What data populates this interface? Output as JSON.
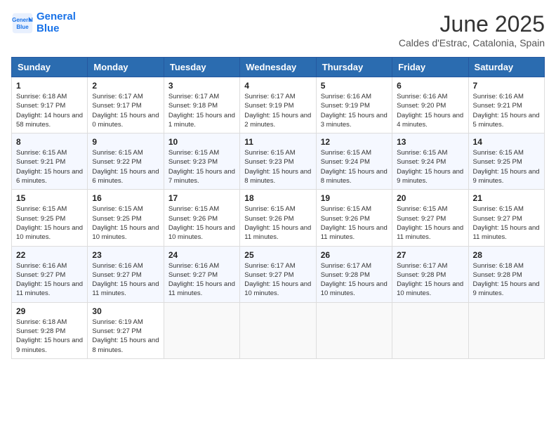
{
  "header": {
    "logo_line1": "General",
    "logo_line2": "Blue",
    "month_year": "June 2025",
    "location": "Caldes d'Estrac, Catalonia, Spain"
  },
  "days_of_week": [
    "Sunday",
    "Monday",
    "Tuesday",
    "Wednesday",
    "Thursday",
    "Friday",
    "Saturday"
  ],
  "weeks": [
    [
      {
        "day": "1",
        "sunrise": "6:18 AM",
        "sunset": "9:17 PM",
        "daylight": "14 hours and 58 minutes."
      },
      {
        "day": "2",
        "sunrise": "6:17 AM",
        "sunset": "9:17 PM",
        "daylight": "15 hours and 0 minutes."
      },
      {
        "day": "3",
        "sunrise": "6:17 AM",
        "sunset": "9:18 PM",
        "daylight": "15 hours and 1 minute."
      },
      {
        "day": "4",
        "sunrise": "6:17 AM",
        "sunset": "9:19 PM",
        "daylight": "15 hours and 2 minutes."
      },
      {
        "day": "5",
        "sunrise": "6:16 AM",
        "sunset": "9:19 PM",
        "daylight": "15 hours and 3 minutes."
      },
      {
        "day": "6",
        "sunrise": "6:16 AM",
        "sunset": "9:20 PM",
        "daylight": "15 hours and 4 minutes."
      },
      {
        "day": "7",
        "sunrise": "6:16 AM",
        "sunset": "9:21 PM",
        "daylight": "15 hours and 5 minutes."
      }
    ],
    [
      {
        "day": "8",
        "sunrise": "6:15 AM",
        "sunset": "9:21 PM",
        "daylight": "15 hours and 6 minutes."
      },
      {
        "day": "9",
        "sunrise": "6:15 AM",
        "sunset": "9:22 PM",
        "daylight": "15 hours and 6 minutes."
      },
      {
        "day": "10",
        "sunrise": "6:15 AM",
        "sunset": "9:23 PM",
        "daylight": "15 hours and 7 minutes."
      },
      {
        "day": "11",
        "sunrise": "6:15 AM",
        "sunset": "9:23 PM",
        "daylight": "15 hours and 8 minutes."
      },
      {
        "day": "12",
        "sunrise": "6:15 AM",
        "sunset": "9:24 PM",
        "daylight": "15 hours and 8 minutes."
      },
      {
        "day": "13",
        "sunrise": "6:15 AM",
        "sunset": "9:24 PM",
        "daylight": "15 hours and 9 minutes."
      },
      {
        "day": "14",
        "sunrise": "6:15 AM",
        "sunset": "9:25 PM",
        "daylight": "15 hours and 9 minutes."
      }
    ],
    [
      {
        "day": "15",
        "sunrise": "6:15 AM",
        "sunset": "9:25 PM",
        "daylight": "15 hours and 10 minutes."
      },
      {
        "day": "16",
        "sunrise": "6:15 AM",
        "sunset": "9:25 PM",
        "daylight": "15 hours and 10 minutes."
      },
      {
        "day": "17",
        "sunrise": "6:15 AM",
        "sunset": "9:26 PM",
        "daylight": "15 hours and 10 minutes."
      },
      {
        "day": "18",
        "sunrise": "6:15 AM",
        "sunset": "9:26 PM",
        "daylight": "15 hours and 11 minutes."
      },
      {
        "day": "19",
        "sunrise": "6:15 AM",
        "sunset": "9:26 PM",
        "daylight": "15 hours and 11 minutes."
      },
      {
        "day": "20",
        "sunrise": "6:15 AM",
        "sunset": "9:27 PM",
        "daylight": "15 hours and 11 minutes."
      },
      {
        "day": "21",
        "sunrise": "6:15 AM",
        "sunset": "9:27 PM",
        "daylight": "15 hours and 11 minutes."
      }
    ],
    [
      {
        "day": "22",
        "sunrise": "6:16 AM",
        "sunset": "9:27 PM",
        "daylight": "15 hours and 11 minutes."
      },
      {
        "day": "23",
        "sunrise": "6:16 AM",
        "sunset": "9:27 PM",
        "daylight": "15 hours and 11 minutes."
      },
      {
        "day": "24",
        "sunrise": "6:16 AM",
        "sunset": "9:27 PM",
        "daylight": "15 hours and 11 minutes."
      },
      {
        "day": "25",
        "sunrise": "6:17 AM",
        "sunset": "9:27 PM",
        "daylight": "15 hours and 10 minutes."
      },
      {
        "day": "26",
        "sunrise": "6:17 AM",
        "sunset": "9:28 PM",
        "daylight": "15 hours and 10 minutes."
      },
      {
        "day": "27",
        "sunrise": "6:17 AM",
        "sunset": "9:28 PM",
        "daylight": "15 hours and 10 minutes."
      },
      {
        "day": "28",
        "sunrise": "6:18 AM",
        "sunset": "9:28 PM",
        "daylight": "15 hours and 9 minutes."
      }
    ],
    [
      {
        "day": "29",
        "sunrise": "6:18 AM",
        "sunset": "9:28 PM",
        "daylight": "15 hours and 9 minutes."
      },
      {
        "day": "30",
        "sunrise": "6:19 AM",
        "sunset": "9:27 PM",
        "daylight": "15 hours and 8 minutes."
      },
      null,
      null,
      null,
      null,
      null
    ]
  ],
  "labels": {
    "sunrise": "Sunrise: ",
    "sunset": "Sunset: ",
    "daylight": "Daylight: "
  }
}
